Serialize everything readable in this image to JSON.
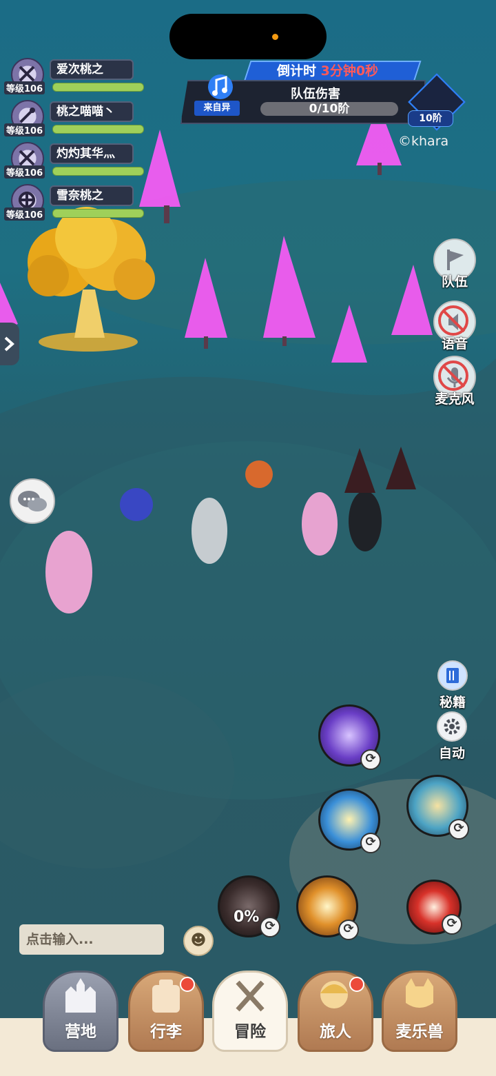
{
  "team": [
    {
      "name": "爱次桃之",
      "level": "等级106",
      "icon": "crossed-swords-icon",
      "hp": 1.0
    },
    {
      "name": "桃之喵喵丶",
      "level": "等级106",
      "icon": "wand-icon",
      "hp": 1.0
    },
    {
      "name": "灼灼其华灬",
      "level": "等级106",
      "icon": "crossed-swords-icon",
      "hp": 1.0
    },
    {
      "name": "雪奈桃之",
      "level": "等级106",
      "icon": "crosshair-shield-icon",
      "hp": 1.0
    }
  ],
  "boss_panel": {
    "countdown_label": "倒计时",
    "countdown_value": "3分钟0秒",
    "title": "队伍伤害",
    "progress": "0/10阶",
    "progress_fraction": 0,
    "source_label": "来自异",
    "tier": "10阶"
  },
  "copyright": "©khara",
  "side_buttons": {
    "team": "队伍",
    "voice": "语音",
    "mic": "麦克风"
  },
  "utility_buttons": {
    "secrets": "秘籍",
    "auto": "自动"
  },
  "skills": {
    "cooldown_percent": "0%"
  },
  "chat": {
    "placeholder": "点击输入...",
    "emoji": "☻"
  },
  "nav": [
    {
      "label": "营地",
      "icon": "castle-icon",
      "badge": false
    },
    {
      "label": "行李",
      "icon": "backpack-icon",
      "badge": true
    },
    {
      "label": "冒险",
      "icon": "crossed-swords-icon",
      "badge": false,
      "active": true
    },
    {
      "label": "旅人",
      "icon": "traveler-icon",
      "badge": true
    },
    {
      "label": "麦乐兽",
      "icon": "pet-icon",
      "badge": false
    }
  ],
  "colors": {
    "accent_blue": "#1f5fd6",
    "hp_green": "#9fd05a",
    "badge_red": "#ec4a3a",
    "countdown_red": "#ff5a5a"
  }
}
